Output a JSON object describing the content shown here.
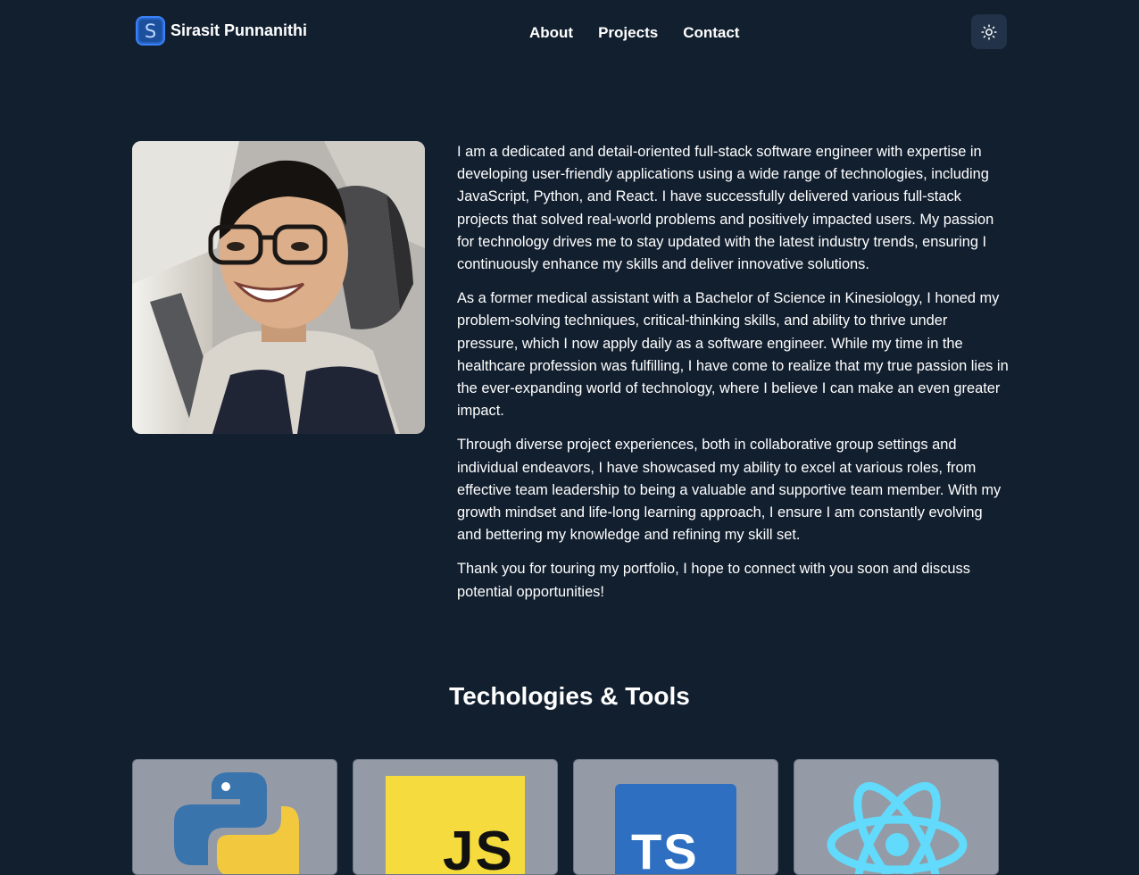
{
  "header": {
    "logo_letter": "S",
    "brand_name": "Sirasit Punnanithi",
    "nav": [
      "About",
      "Projects",
      "Contact"
    ],
    "theme_toggle_icon": "sun-icon"
  },
  "about": {
    "photo_alt": "",
    "paragraphs": [
      "I am a dedicated and detail-oriented full-stack software engineer with expertise in developing user-friendly applications using a wide range of technologies, including JavaScript, Python, and React. I have successfully delivered various full-stack projects that solved real-world problems and positively impacted users. My passion for technology drives me to stay updated with the latest industry trends, ensuring I continuously enhance my skills and deliver innovative solutions.",
      "As a former medical assistant with a Bachelor of Science in Kinesiology, I honed my problem-solving techniques, critical-thinking skills, and ability to thrive under pressure, which I now apply daily as a software engineer. While my time in the healthcare profession was fulfilling, I have come to realize that my true passion lies in the ever-expanding world of technology, where I believe I can make an even greater impact.",
      "Through diverse project experiences, both in collaborative group settings and individual endeavors, I have showcased my ability to excel at various roles, from effective team leadership to being a valuable and supportive team member. With my growth mindset and life-long learning approach, I ensure I am constantly evolving and bettering my knowledge and refining my skill set.",
      "Thank you for touring my portfolio, I hope to connect with you soon and discuss potential opportunities!"
    ]
  },
  "technologies": {
    "title": "Techologies & Tools",
    "items": [
      {
        "icon": "python-logo-icon",
        "logo_text": ""
      },
      {
        "icon": "javascript-logo-icon",
        "logo_text": "JS"
      },
      {
        "icon": "typescript-logo-icon",
        "logo_text": "TS"
      },
      {
        "icon": "react-logo-icon",
        "logo_text": ""
      }
    ]
  },
  "colors": {
    "background": "#121f2f",
    "accent": "#3b82f6",
    "card": "#949ba6",
    "js_yellow": "#f7df1e",
    "ts_blue": "#3178c6",
    "react_cyan": "#61dafb"
  }
}
